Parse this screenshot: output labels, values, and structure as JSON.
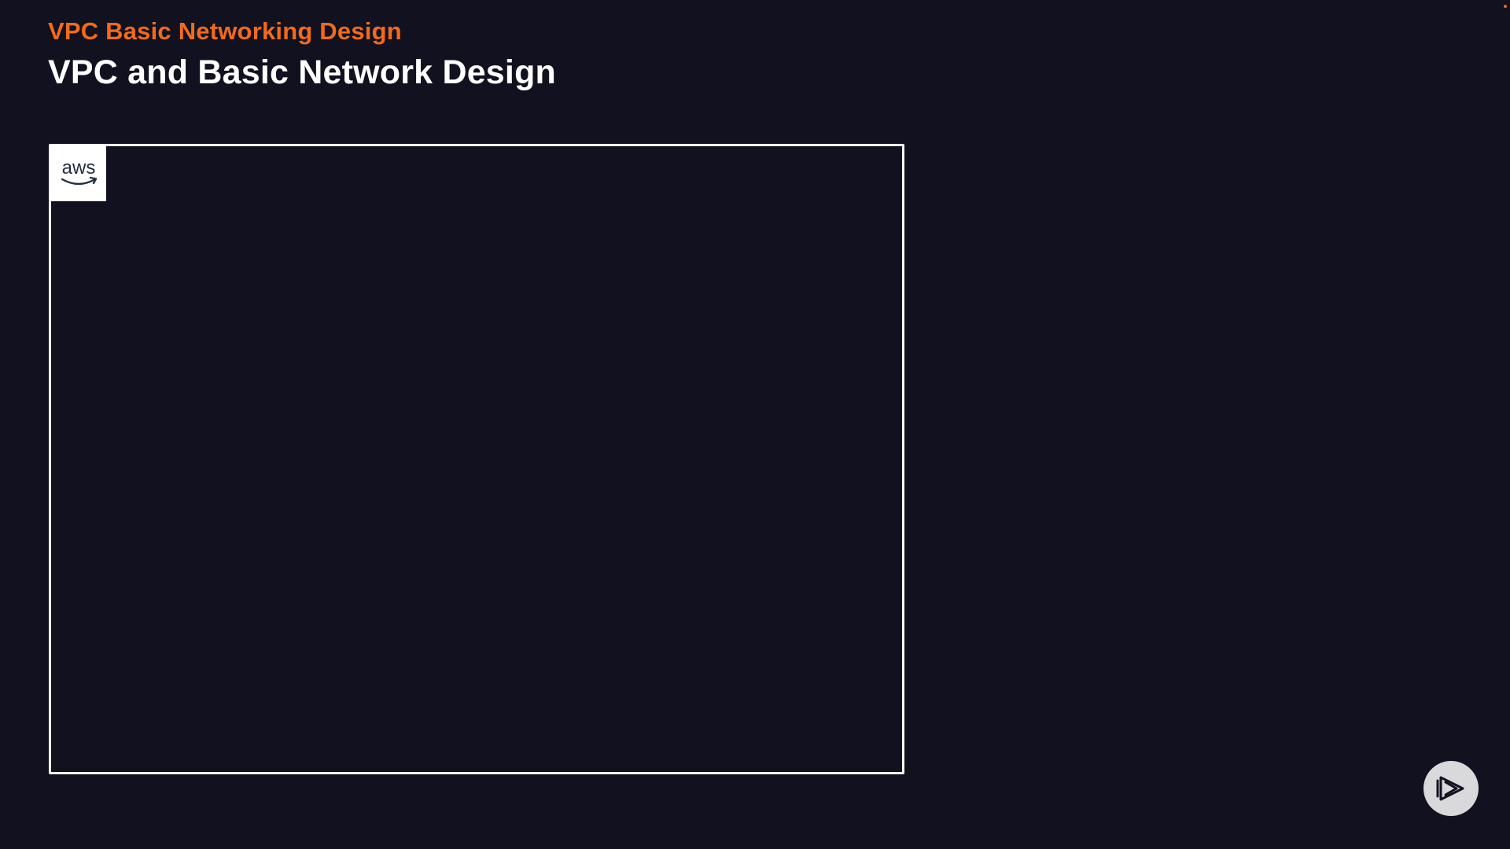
{
  "slide": {
    "subtitle": "VPC Basic Networking Design",
    "title": "VPC and Basic Network Design"
  },
  "diagram": {
    "badge": {
      "label": "aws",
      "icon": "aws-logo-icon"
    }
  },
  "branding": {
    "icon": "play-logo-icon"
  },
  "colors": {
    "background": "#12111f",
    "accent": "#f26a1b",
    "title": "#ffffff",
    "frame": "#ffffff"
  }
}
